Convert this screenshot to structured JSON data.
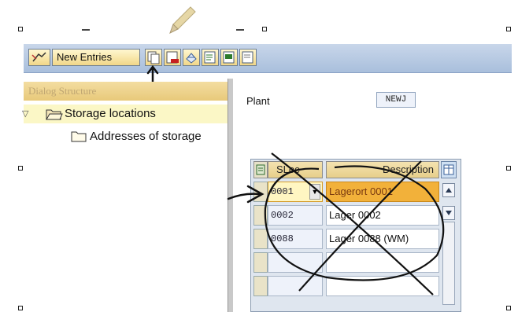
{
  "toolbar": {
    "new_entries_label": "New Entries",
    "icons": [
      "display-change-icon",
      "copy-icon",
      "delete-icon",
      "undo-icon",
      "select-all-icon",
      "select-block-icon",
      "deselect-all-icon"
    ]
  },
  "dialog_structure": {
    "title": "Dialog Structure",
    "items": [
      {
        "label": "Storage locations",
        "icon": "folder-open-icon",
        "selected": true
      },
      {
        "label": "Addresses of storage",
        "icon": "folder-icon",
        "selected": false
      }
    ]
  },
  "form": {
    "plant_label": "Plant",
    "plant_value": "NEWJ"
  },
  "table": {
    "columns": [
      "SLoc",
      "Description"
    ],
    "rows": [
      {
        "sloc": "0001",
        "description": "Lagerort 0001",
        "selected": true
      },
      {
        "sloc": "0002",
        "description": "Lager 0002",
        "selected": false
      },
      {
        "sloc": "0088",
        "description": "Lager 0088 (WM)",
        "selected": false
      }
    ]
  },
  "colors": {
    "toolbar": "#b4c7e2",
    "header": "#e9cd80",
    "selected_row": "#f2b13a",
    "annotation": "#111111"
  }
}
